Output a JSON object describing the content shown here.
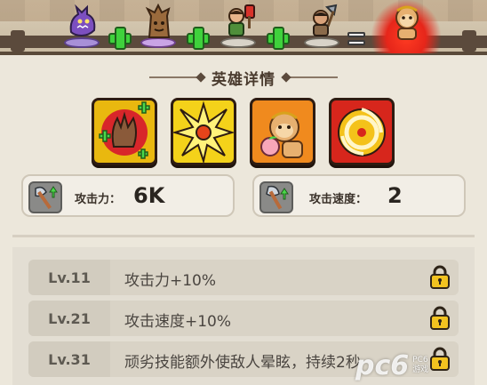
{
  "recipe": {
    "units": [
      {
        "icon": "purple-dragon-icon"
      },
      {
        "icon": "tree-stump-icon"
      },
      {
        "icon": "hammer-warrior-icon"
      },
      {
        "icon": "axe-warrior-icon"
      },
      {
        "icon": "monkey-king-icon"
      }
    ],
    "operators": [
      "plus",
      "plus",
      "plus",
      "equals"
    ],
    "colors": {
      "plus": "#3fd13c",
      "glow": "#e6261a"
    }
  },
  "section_title": "英雄详情",
  "skills": [
    {
      "icon": "claw-plus-icon"
    },
    {
      "icon": "starburst-icon"
    },
    {
      "icon": "monkey-peach-icon"
    },
    {
      "icon": "spinning-ring-icon"
    }
  ],
  "stats": {
    "attack": {
      "label": "攻击力：",
      "value": "6K",
      "icon": "axe-up-icon"
    },
    "speed": {
      "label": "攻击速度：",
      "value": "2",
      "icon": "axe-speed-icon"
    }
  },
  "levels": [
    {
      "level": "Lv.11",
      "text": "攻击力+10%",
      "icon": "lock-icon"
    },
    {
      "level": "Lv.21",
      "text": "攻击速度+10%",
      "icon": "lock-icon"
    },
    {
      "level": "Lv.31",
      "text": "顽劣技能额外使敌人晕眩，持续2秒",
      "icon": "lock-icon"
    }
  ],
  "watermark": {
    "brand": "pc6",
    "sub1": "PC6",
    "sub2": "游戏"
  }
}
